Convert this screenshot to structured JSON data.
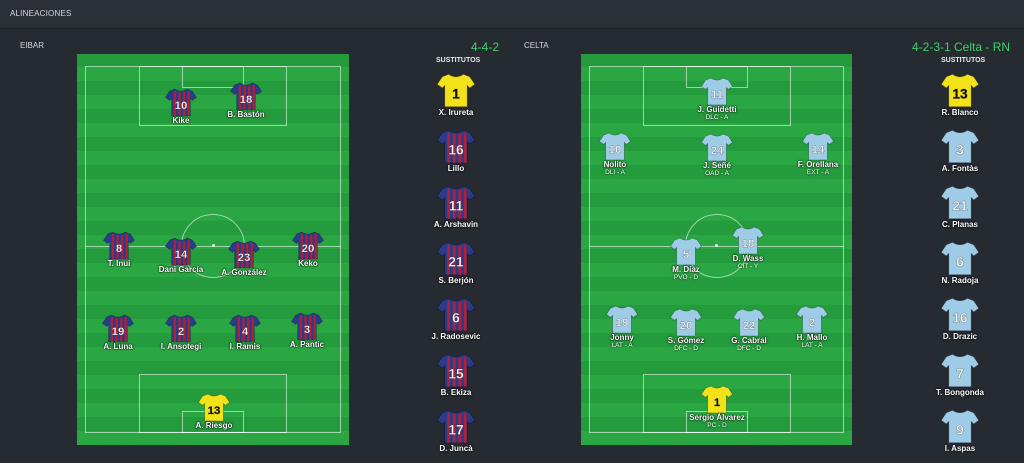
{
  "header": {
    "title": "ALINEACIONES"
  },
  "home": {
    "team": "EIBAR",
    "formation": "4-4-2",
    "subs_title": "SUSTITUTOS",
    "colors": {
      "stripe_a": "#2a3b8c",
      "stripe_b": "#b8202f",
      "keeper": "#f2e21a"
    },
    "players": [
      {
        "number": "10",
        "name": "Kike",
        "kit": "field"
      },
      {
        "number": "18",
        "name": "B. Bastón",
        "kit": "field"
      },
      {
        "number": "8",
        "name": "T. Inui",
        "kit": "field"
      },
      {
        "number": "14",
        "name": "Dani García",
        "kit": "field"
      },
      {
        "number": "23",
        "name": "A. González",
        "kit": "field"
      },
      {
        "number": "20",
        "name": "Keko",
        "kit": "field"
      },
      {
        "number": "19",
        "name": "A. Luna",
        "kit": "field"
      },
      {
        "number": "2",
        "name": "I. Ansotegi",
        "kit": "field"
      },
      {
        "number": "4",
        "name": "I. Ramis",
        "kit": "field"
      },
      {
        "number": "3",
        "name": "A. Pantic",
        "kit": "field"
      },
      {
        "number": "13",
        "name": "A. Riesgo",
        "kit": "keeper"
      }
    ],
    "subs": [
      {
        "number": "1",
        "name": "X. Irureta",
        "kit": "keeper"
      },
      {
        "number": "16",
        "name": "Lillo",
        "kit": "field"
      },
      {
        "number": "11",
        "name": "A. Arshavin",
        "kit": "field"
      },
      {
        "number": "21",
        "name": "S. Berjón",
        "kit": "field"
      },
      {
        "number": "6",
        "name": "J. Radosevic",
        "kit": "field"
      },
      {
        "number": "15",
        "name": "B. Ekiza",
        "kit": "field"
      },
      {
        "number": "17",
        "name": "D. Juncà",
        "kit": "field"
      }
    ]
  },
  "away": {
    "team": "CELTA",
    "formation": "4-2-3-1 Celta - RN",
    "subs_title": "SUSTITUTOS",
    "colors": {
      "shirt": "#9ecbe6",
      "keeper": "#f2e21a"
    },
    "players": [
      {
        "number": "11",
        "name": "J. Guidetti",
        "role": "DLC - A",
        "kit": "field"
      },
      {
        "number": "10",
        "name": "Nolito",
        "role": "DLI - A",
        "kit": "field"
      },
      {
        "number": "24",
        "name": "J. Señé",
        "role": "OAD - A",
        "kit": "field"
      },
      {
        "number": "14",
        "name": "F. Orellana",
        "role": "EXT - A",
        "kit": "field"
      },
      {
        "number": "5",
        "name": "M. Díaz",
        "role": "PVO - D",
        "kit": "field"
      },
      {
        "number": "18",
        "name": "D. Wass",
        "role": "CIT - Y",
        "kit": "field"
      },
      {
        "number": "19",
        "name": "Jonny",
        "role": "LAT - A",
        "kit": "field"
      },
      {
        "number": "20",
        "name": "S. Gómez",
        "role": "DFC - D",
        "kit": "field"
      },
      {
        "number": "22",
        "name": "G. Cabral",
        "role": "DFC - D",
        "kit": "field"
      },
      {
        "number": "2",
        "name": "H. Mallo",
        "role": "LAT - A",
        "kit": "field"
      },
      {
        "number": "1",
        "name": "Sergio Álvarez",
        "role": "PC - D",
        "kit": "keeper"
      }
    ],
    "subs": [
      {
        "number": "13",
        "name": "R. Blanco",
        "kit": "keeper"
      },
      {
        "number": "3",
        "name": "A. Fontàs",
        "kit": "field"
      },
      {
        "number": "21",
        "name": "C. Planas",
        "kit": "field"
      },
      {
        "number": "6",
        "name": "N. Radoja",
        "kit": "field"
      },
      {
        "number": "16",
        "name": "D. Drazic",
        "kit": "field"
      },
      {
        "number": "7",
        "name": "T. Bongonda",
        "kit": "field"
      },
      {
        "number": "9",
        "name": "I. Aspas",
        "kit": "field"
      }
    ]
  }
}
